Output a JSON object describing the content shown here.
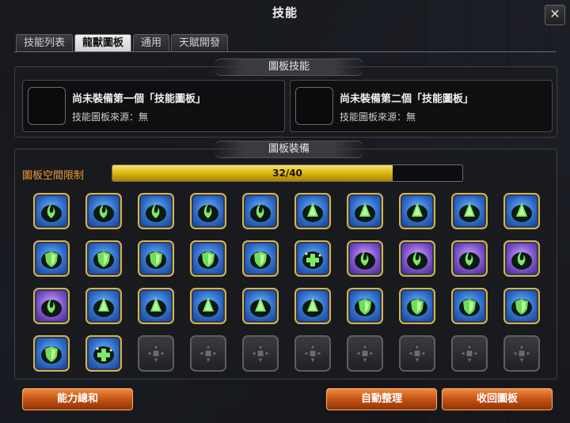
{
  "window": {
    "title": "技能"
  },
  "tabs": [
    {
      "label": "技能列表",
      "active": false
    },
    {
      "label": "龍獸圖板",
      "active": true
    },
    {
      "label": "通用",
      "active": false
    },
    {
      "label": "天賦開發",
      "active": false
    }
  ],
  "plate_skills": {
    "header": "圖板技能",
    "plates": [
      {
        "name": "尚未裝備第一個「技能圖板」",
        "source": "技能圖板來源：無"
      },
      {
        "name": "尚未裝備第二個「技能圖板」",
        "source": "技能圖板來源：無"
      }
    ]
  },
  "plate_equip": {
    "header": "圖板裝備",
    "capacity_label": "圖板空間限制",
    "capacity_text": "32/40",
    "capacity_used": 32,
    "capacity_max": 40,
    "slots": [
      "swirl",
      "swirl",
      "swirl",
      "swirl",
      "swirl",
      "cone",
      "cone",
      "cone",
      "cone",
      "cone",
      "shield",
      "shield",
      "shield",
      "shield",
      "shield",
      "heal",
      "swirl-purple",
      "swirl-purple",
      "swirl-purple",
      "swirl-purple",
      "swirl-purple",
      "cone",
      "cone",
      "cone",
      "cone",
      "cone",
      "shield",
      "shield",
      "shield",
      "shield",
      "shield",
      "heal",
      "empty",
      "empty",
      "empty",
      "empty",
      "empty",
      "empty",
      "empty",
      "empty"
    ]
  },
  "buttons": {
    "ability_total": "能力總和",
    "auto_sort": "自動整理",
    "retrieve_plates": "收回圖板"
  },
  "colors": {
    "accent_orange": "#f29a2e",
    "slot_border_gold": "#d8b547",
    "bar_fill": "#d8b10a"
  }
}
